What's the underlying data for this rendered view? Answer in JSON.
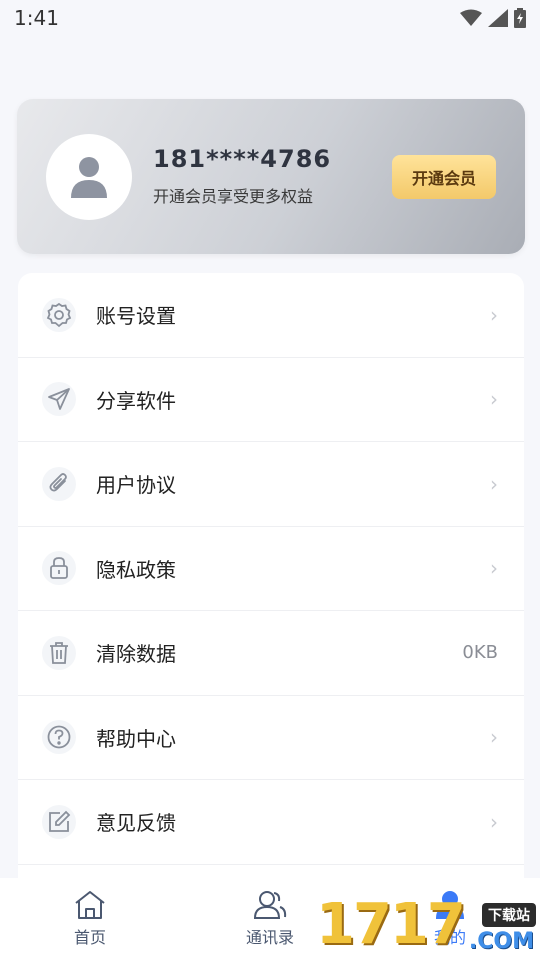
{
  "status_bar": {
    "time": "1:41"
  },
  "profile": {
    "phone": "181****4786",
    "subtitle": "开通会员享受更多权益",
    "vip_button": "开通会员"
  },
  "menu": {
    "items": [
      {
        "label": "账号设置",
        "icon": "gear-icon",
        "value": ""
      },
      {
        "label": "分享软件",
        "icon": "send-icon",
        "value": ""
      },
      {
        "label": "用户协议",
        "icon": "paperclip-icon",
        "value": ""
      },
      {
        "label": "隐私政策",
        "icon": "lock-icon",
        "value": ""
      },
      {
        "label": "清除数据",
        "icon": "trash-icon",
        "value": "0KB"
      },
      {
        "label": "帮助中心",
        "icon": "question-icon",
        "value": ""
      },
      {
        "label": "意见反馈",
        "icon": "edit-icon",
        "value": ""
      }
    ]
  },
  "tabs": [
    {
      "label": "首页",
      "icon": "home-icon"
    },
    {
      "label": "通讯录",
      "icon": "contacts-icon"
    },
    {
      "label": "我的",
      "icon": "profile-icon"
    }
  ],
  "watermark": {
    "number": "1717",
    "site_badge": "下载站",
    "domain": ".COM"
  },
  "colors": {
    "accent": "#3b7af7",
    "vip_gold": "#f3c96a",
    "background": "#f6f7fb"
  }
}
